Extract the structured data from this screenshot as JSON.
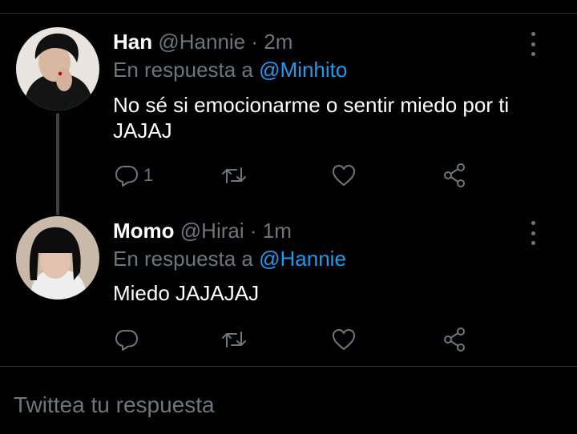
{
  "tweets": [
    {
      "display_name": "Han",
      "handle": "@Hannie",
      "separator": "·",
      "time": "2m",
      "reply_prefix": "En respuesta a",
      "reply_to": "@Minhito",
      "text": "No sé si emocionarme o sentir miedo por ti JAJAJ",
      "reply_count": "1",
      "avatar_colors": {
        "bg": "#e9e4df",
        "hair": "#111111",
        "skin": "#d9b8a2"
      }
    },
    {
      "display_name": "Momo",
      "handle": "@Hirai",
      "separator": "·",
      "time": "1m",
      "reply_prefix": "En respuesta a",
      "reply_to": "@Hannie",
      "text": "Miedo JAJAJAJ",
      "reply_count": "",
      "avatar_colors": {
        "bg": "#c9b9a8",
        "hair": "#0d0d0d",
        "skin": "#e2c2ae"
      }
    }
  ],
  "icons": [
    "reply-icon",
    "retweet-icon",
    "like-icon",
    "share-icon",
    "more-icon"
  ],
  "compose": {
    "placeholder": "Twittea tu respuesta"
  },
  "colors": {
    "background": "#000000",
    "muted": "#6e767d",
    "accent": "#1d9bf0",
    "text": "#ffffff"
  }
}
